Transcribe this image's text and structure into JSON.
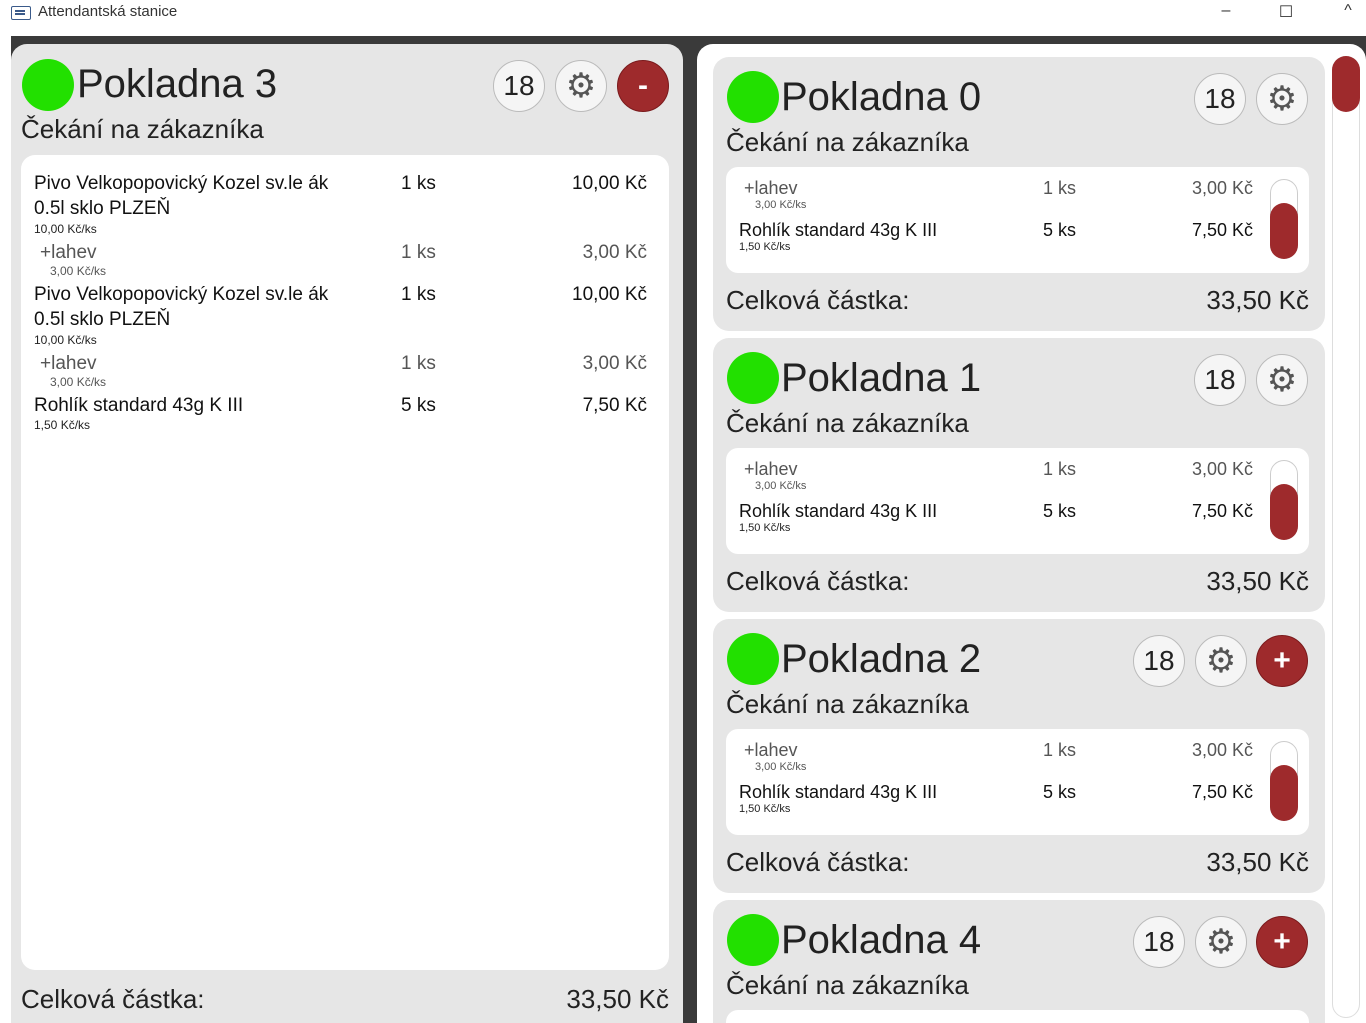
{
  "window": {
    "title": "Attendantská stanice",
    "minimize": "–",
    "maximize": "☐",
    "close": "^"
  },
  "main": {
    "register_name": "Pokladna 3",
    "status": "Čekání na zákazníka",
    "count": "18",
    "remove_label": "-",
    "status_color": "#22e000",
    "items": [
      {
        "name": "Pivo Velkopopovický Kozel sv.le ák",
        "name2": "0.5l sklo PLZEŇ",
        "qty": "1 ks",
        "price": "10,00 Kč",
        "unit": "10,00 Kč/ks"
      },
      {
        "name": "+lahev",
        "qty": "1 ks",
        "price": "3,00 Kč",
        "unit": "3,00 Kč/ks"
      },
      {
        "name": "Pivo Velkopopovický Kozel sv.le ák",
        "name2": "0.5l sklo PLZEŇ",
        "qty": "1 ks",
        "price": "10,00 Kč",
        "unit": "10,00 Kč/ks"
      },
      {
        "name": "+lahev",
        "qty": "1 ks",
        "price": "3,00 Kč",
        "unit": "3,00 Kč/ks"
      },
      {
        "name": "Rohlík standard 43g K III",
        "qty": "5 ks",
        "price": "7,50 Kč",
        "unit": "1,50 Kč/ks"
      }
    ],
    "total_label": "Celková částka:",
    "total_value": "33,50 Kč"
  },
  "registers": [
    {
      "register_name": "Pokladna 0",
      "status": "Čekání na zákazníka",
      "count": "18",
      "items": [
        {
          "name": "+lahev",
          "qty": "1 ks",
          "price": "3,00 Kč",
          "unit": "3,00 Kč/ks"
        },
        {
          "name": "Rohlík standard 43g K III",
          "qty": "5 ks",
          "price": "7,50 Kč",
          "unit": "1,50 Kč/ks"
        }
      ],
      "total_label": "Celková částka:",
      "total_value": "33,50 Kč"
    },
    {
      "register_name": "Pokladna 1",
      "status": "Čekání na zákazníka",
      "count": "18",
      "items": [
        {
          "name": "+lahev",
          "qty": "1 ks",
          "price": "3,00 Kč",
          "unit": "3,00 Kč/ks"
        },
        {
          "name": "Rohlík standard 43g K III",
          "qty": "5 ks",
          "price": "7,50 Kč",
          "unit": "1,50 Kč/ks"
        }
      ],
      "total_label": "Celková částka:",
      "total_value": "33,50 Kč"
    },
    {
      "register_name": "Pokladna 2",
      "status": "Čekání na zákazníka",
      "count": "18",
      "add_label": "+",
      "items": [
        {
          "name": "+lahev",
          "qty": "1 ks",
          "price": "3,00 Kč",
          "unit": "3,00 Kč/ks"
        },
        {
          "name": "Rohlík standard 43g K III",
          "qty": "5 ks",
          "price": "7,50 Kč",
          "unit": "1,50 Kč/ks"
        }
      ],
      "total_label": "Celková částka:",
      "total_value": "33,50 Kč"
    },
    {
      "register_name": "Pokladna 4",
      "status": "Čekání na zákazníka",
      "count": "18",
      "add_label": "+"
    }
  ],
  "icons": {
    "settings": "gear-icon",
    "remove": "minus-icon",
    "add": "plus-icon",
    "app": "window-app-icon"
  },
  "colors": {
    "online": "#22e000",
    "accent": "#9e2a2c",
    "panel": "#e6e6e6",
    "frame": "#3a3a3a"
  }
}
